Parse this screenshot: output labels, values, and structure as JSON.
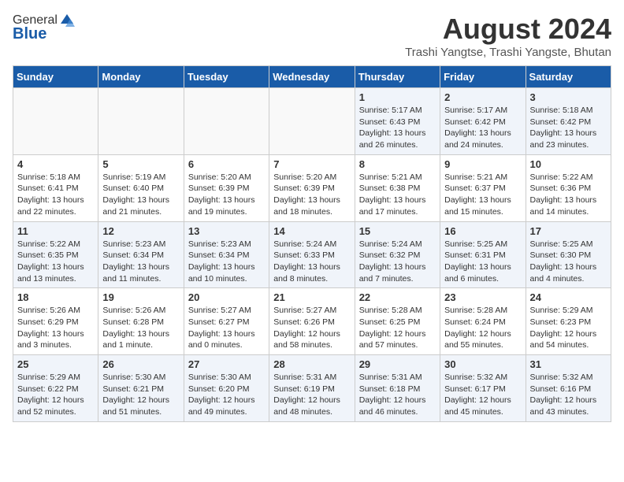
{
  "header": {
    "logo_general": "General",
    "logo_blue": "Blue",
    "month_title": "August 2024",
    "subtitle": "Trashi Yangtse, Trashi Yangste, Bhutan"
  },
  "days_of_week": [
    "Sunday",
    "Monday",
    "Tuesday",
    "Wednesday",
    "Thursday",
    "Friday",
    "Saturday"
  ],
  "weeks": [
    [
      {
        "day": "",
        "detail": ""
      },
      {
        "day": "",
        "detail": ""
      },
      {
        "day": "",
        "detail": ""
      },
      {
        "day": "",
        "detail": ""
      },
      {
        "day": "1",
        "detail": "Sunrise: 5:17 AM\nSunset: 6:43 PM\nDaylight: 13 hours and 26 minutes."
      },
      {
        "day": "2",
        "detail": "Sunrise: 5:17 AM\nSunset: 6:42 PM\nDaylight: 13 hours and 24 minutes."
      },
      {
        "day": "3",
        "detail": "Sunrise: 5:18 AM\nSunset: 6:42 PM\nDaylight: 13 hours and 23 minutes."
      }
    ],
    [
      {
        "day": "4",
        "detail": "Sunrise: 5:18 AM\nSunset: 6:41 PM\nDaylight: 13 hours and 22 minutes."
      },
      {
        "day": "5",
        "detail": "Sunrise: 5:19 AM\nSunset: 6:40 PM\nDaylight: 13 hours and 21 minutes."
      },
      {
        "day": "6",
        "detail": "Sunrise: 5:20 AM\nSunset: 6:39 PM\nDaylight: 13 hours and 19 minutes."
      },
      {
        "day": "7",
        "detail": "Sunrise: 5:20 AM\nSunset: 6:39 PM\nDaylight: 13 hours and 18 minutes."
      },
      {
        "day": "8",
        "detail": "Sunrise: 5:21 AM\nSunset: 6:38 PM\nDaylight: 13 hours and 17 minutes."
      },
      {
        "day": "9",
        "detail": "Sunrise: 5:21 AM\nSunset: 6:37 PM\nDaylight: 13 hours and 15 minutes."
      },
      {
        "day": "10",
        "detail": "Sunrise: 5:22 AM\nSunset: 6:36 PM\nDaylight: 13 hours and 14 minutes."
      }
    ],
    [
      {
        "day": "11",
        "detail": "Sunrise: 5:22 AM\nSunset: 6:35 PM\nDaylight: 13 hours and 13 minutes."
      },
      {
        "day": "12",
        "detail": "Sunrise: 5:23 AM\nSunset: 6:34 PM\nDaylight: 13 hours and 11 minutes."
      },
      {
        "day": "13",
        "detail": "Sunrise: 5:23 AM\nSunset: 6:34 PM\nDaylight: 13 hours and 10 minutes."
      },
      {
        "day": "14",
        "detail": "Sunrise: 5:24 AM\nSunset: 6:33 PM\nDaylight: 13 hours and 8 minutes."
      },
      {
        "day": "15",
        "detail": "Sunrise: 5:24 AM\nSunset: 6:32 PM\nDaylight: 13 hours and 7 minutes."
      },
      {
        "day": "16",
        "detail": "Sunrise: 5:25 AM\nSunset: 6:31 PM\nDaylight: 13 hours and 6 minutes."
      },
      {
        "day": "17",
        "detail": "Sunrise: 5:25 AM\nSunset: 6:30 PM\nDaylight: 13 hours and 4 minutes."
      }
    ],
    [
      {
        "day": "18",
        "detail": "Sunrise: 5:26 AM\nSunset: 6:29 PM\nDaylight: 13 hours and 3 minutes."
      },
      {
        "day": "19",
        "detail": "Sunrise: 5:26 AM\nSunset: 6:28 PM\nDaylight: 13 hours and 1 minute."
      },
      {
        "day": "20",
        "detail": "Sunrise: 5:27 AM\nSunset: 6:27 PM\nDaylight: 13 hours and 0 minutes."
      },
      {
        "day": "21",
        "detail": "Sunrise: 5:27 AM\nSunset: 6:26 PM\nDaylight: 12 hours and 58 minutes."
      },
      {
        "day": "22",
        "detail": "Sunrise: 5:28 AM\nSunset: 6:25 PM\nDaylight: 12 hours and 57 minutes."
      },
      {
        "day": "23",
        "detail": "Sunrise: 5:28 AM\nSunset: 6:24 PM\nDaylight: 12 hours and 55 minutes."
      },
      {
        "day": "24",
        "detail": "Sunrise: 5:29 AM\nSunset: 6:23 PM\nDaylight: 12 hours and 54 minutes."
      }
    ],
    [
      {
        "day": "25",
        "detail": "Sunrise: 5:29 AM\nSunset: 6:22 PM\nDaylight: 12 hours and 52 minutes."
      },
      {
        "day": "26",
        "detail": "Sunrise: 5:30 AM\nSunset: 6:21 PM\nDaylight: 12 hours and 51 minutes."
      },
      {
        "day": "27",
        "detail": "Sunrise: 5:30 AM\nSunset: 6:20 PM\nDaylight: 12 hours and 49 minutes."
      },
      {
        "day": "28",
        "detail": "Sunrise: 5:31 AM\nSunset: 6:19 PM\nDaylight: 12 hours and 48 minutes."
      },
      {
        "day": "29",
        "detail": "Sunrise: 5:31 AM\nSunset: 6:18 PM\nDaylight: 12 hours and 46 minutes."
      },
      {
        "day": "30",
        "detail": "Sunrise: 5:32 AM\nSunset: 6:17 PM\nDaylight: 12 hours and 45 minutes."
      },
      {
        "day": "31",
        "detail": "Sunrise: 5:32 AM\nSunset: 6:16 PM\nDaylight: 12 hours and 43 minutes."
      }
    ]
  ]
}
